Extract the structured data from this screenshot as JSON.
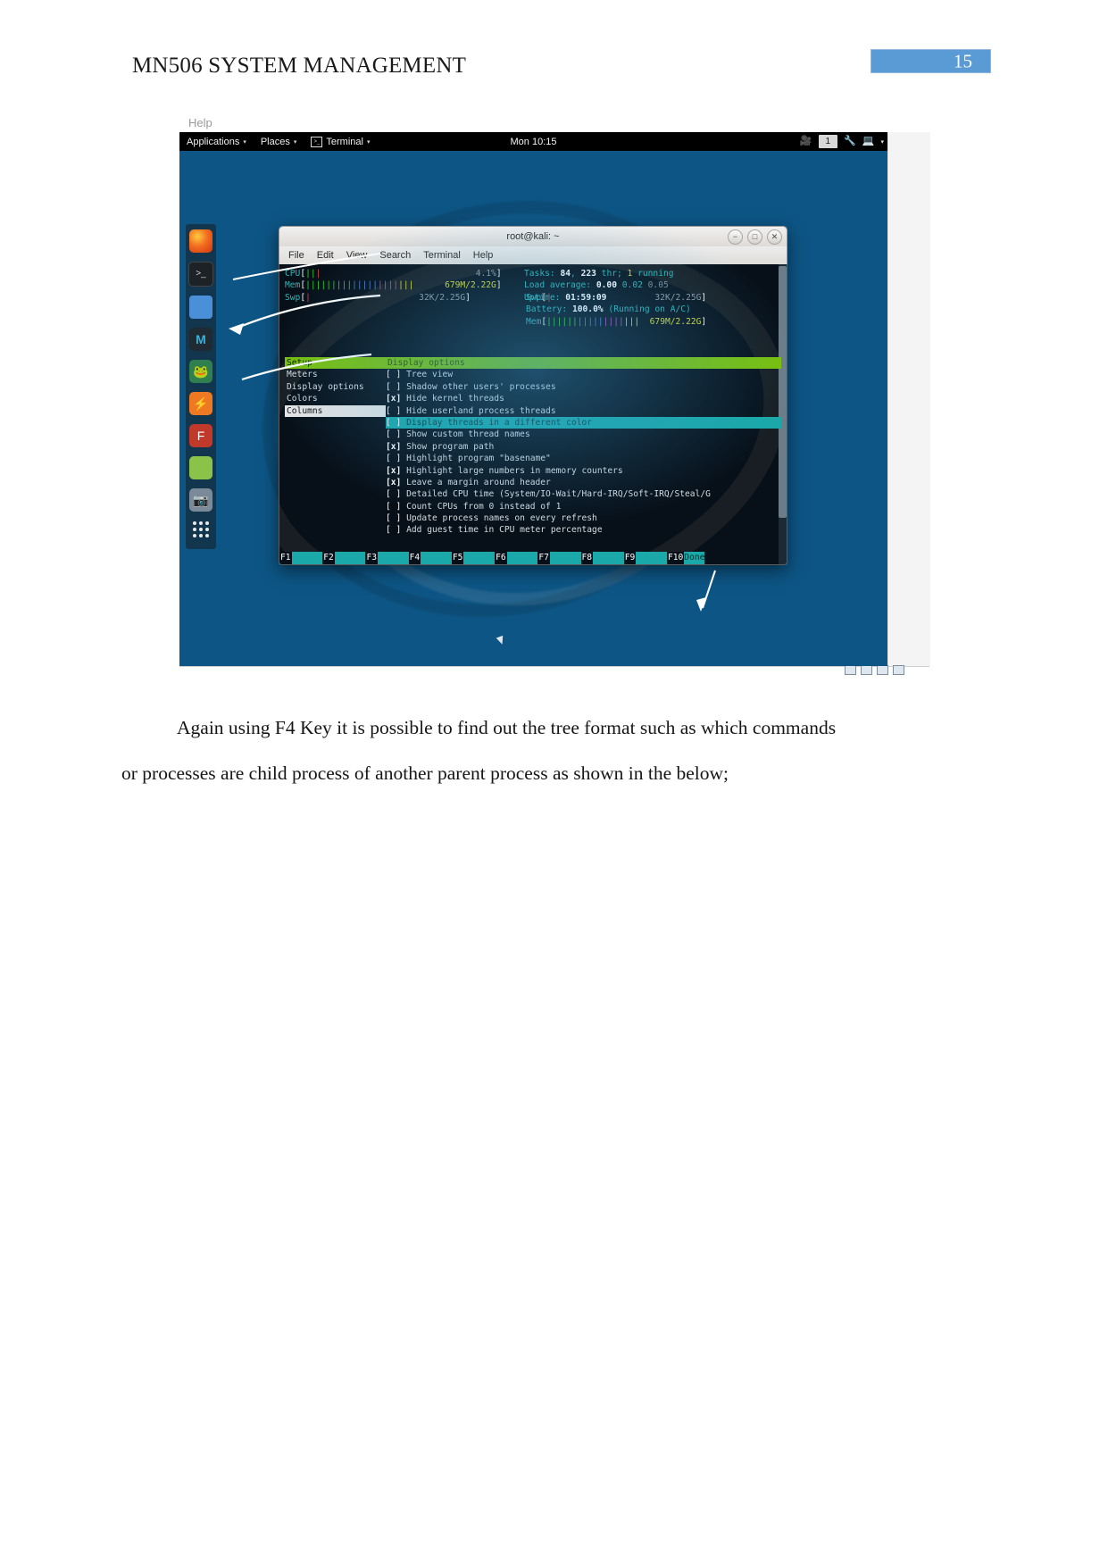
{
  "document": {
    "header_title": "MN506 SYSTEM MANAGEMENT",
    "page_number": "15",
    "badge_color": "#5b9bd5",
    "paragraph_line1": "Again using F4 Key  it is possible to find out the tree format such as which commands",
    "paragraph_line2": "or processes are child process of  another parent process as shown in the below;"
  },
  "embedded_screenshot": {
    "help_label": "Help",
    "gnome_panel": {
      "applications": "Applications",
      "places": "Places",
      "terminal": "Terminal",
      "clock": "Mon 10:15",
      "workspace": "1",
      "caret": "▾",
      "recorder_icon": "recorder-icon",
      "tool_icon": "tool-icon",
      "network_icon": "network-icon"
    },
    "dock": [
      {
        "name": "firefox",
        "label": ""
      },
      {
        "name": "terminal",
        "label": ">_"
      },
      {
        "name": "files",
        "label": ""
      },
      {
        "name": "metasploit",
        "label": "M"
      },
      {
        "name": "dragon",
        "label": ""
      },
      {
        "name": "burpsuite",
        "label": ""
      },
      {
        "name": "faraday",
        "label": "F"
      },
      {
        "name": "notes",
        "label": ""
      },
      {
        "name": "screenshot",
        "label": ""
      },
      {
        "name": "show-applications",
        "label": ""
      }
    ],
    "terminal_window": {
      "title": "root@kali: ~",
      "menu": [
        "File",
        "Edit",
        "View",
        "Search",
        "Terminal",
        "Help"
      ],
      "window_buttons": {
        "minimize": "−",
        "maximize": "□",
        "close": "✕"
      }
    },
    "htop": {
      "meters_left": [
        {
          "label": "CPU",
          "bar": "|||",
          "bar_fill_colors": [
            "green",
            "red"
          ],
          "value": "4.1%"
        },
        {
          "label": "Mem",
          "bar": "||||||||||||||||||||",
          "value": "679M/2.22G"
        },
        {
          "label": "Swp",
          "bar": "|",
          "value": "32K/2.25G"
        }
      ],
      "meters_right": [
        {
          "text_parts": [
            "Tasks: ",
            "84",
            ", ",
            "223",
            " thr; ",
            "1",
            " running"
          ]
        },
        {
          "text_parts": [
            "Load average: ",
            "0.00",
            " ",
            "0.02",
            " ",
            "0.05"
          ]
        },
        {
          "text_parts": [
            "Uptime: ",
            "01:59:09"
          ]
        },
        {
          "label": "Swp",
          "bar": "|",
          "value": "32K/2.25G"
        },
        {
          "text_parts": [
            "Battery: ",
            "100.0%",
            " (Running on A/C)"
          ]
        },
        {
          "label": "Mem",
          "bar": "||||||||||||||||||",
          "value": "679M/2.22G"
        }
      ],
      "setup": {
        "left_header": "Setup",
        "left_items": [
          "Meters",
          "Display options",
          "Colors",
          "Columns"
        ],
        "left_selected_index": 3,
        "right_header": "Display options",
        "options": [
          {
            "checked": false,
            "label": "Tree view"
          },
          {
            "checked": false,
            "label": "Shadow other users' processes"
          },
          {
            "checked": true,
            "label": "Hide kernel threads"
          },
          {
            "checked": false,
            "label": "Hide userland process threads"
          },
          {
            "checked": false,
            "label": "Display threads in a different color",
            "selected": true
          },
          {
            "checked": false,
            "label": "Show custom thread names"
          },
          {
            "checked": true,
            "label": "Show program path"
          },
          {
            "checked": false,
            "label": "Highlight program \"basename\""
          },
          {
            "checked": true,
            "label": "Highlight large numbers in memory counters"
          },
          {
            "checked": true,
            "label": "Leave a margin around header"
          },
          {
            "checked": false,
            "label": "Detailed CPU time (System/IO-Wait/Hard-IRQ/Soft-IRQ/Steal/G"
          },
          {
            "checked": false,
            "label": "Count CPUs from 0 instead of 1"
          },
          {
            "checked": false,
            "label": "Update process names on every refresh"
          },
          {
            "checked": false,
            "label": "Add guest time in CPU meter percentage"
          }
        ],
        "function_keys": [
          {
            "num": "F1",
            "label": "      "
          },
          {
            "num": "F2",
            "label": "      "
          },
          {
            "num": "F3",
            "label": "      "
          },
          {
            "num": "F4",
            "label": "      "
          },
          {
            "num": "F5",
            "label": "      "
          },
          {
            "num": "F6",
            "label": "      "
          },
          {
            "num": "F7",
            "label": "      "
          },
          {
            "num": "F8",
            "label": "      "
          },
          {
            "num": "F9",
            "label": "      "
          },
          {
            "num": "F10",
            "label": "Done"
          }
        ]
      }
    }
  }
}
